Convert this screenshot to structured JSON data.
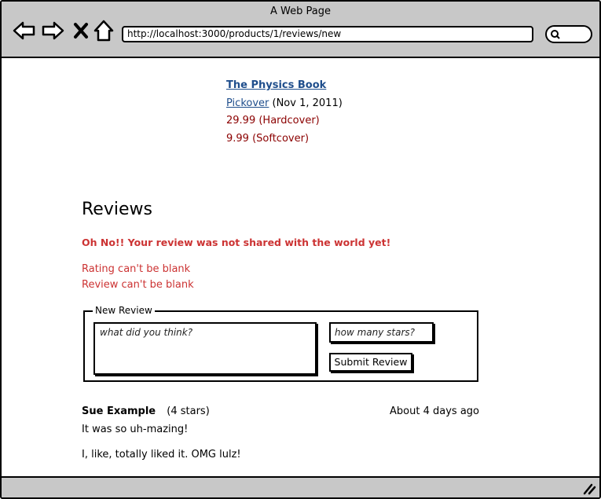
{
  "window": {
    "title": "A Web Page"
  },
  "toolbar": {
    "url": "http://localhost:3000/products/1/reviews/new",
    "icons": [
      "back-arrow-icon",
      "forward-arrow-icon",
      "close-x-icon",
      "home-icon",
      "search-icon"
    ]
  },
  "product": {
    "title": "The Physics Book",
    "author": "Pickover",
    "date": "(Nov 1, 2011)",
    "prices": [
      "29.99 (Hardcover)",
      "9.99 (Softcover)"
    ]
  },
  "reviews": {
    "heading": "Reviews",
    "flash": "Oh No!!  Your review was not shared with the world yet!",
    "errors": [
      "Rating can't be blank",
      "Review can't be blank"
    ],
    "form": {
      "legend": "New Review",
      "review_placeholder": "what did you think?",
      "stars_placeholder": "how many stars?",
      "submit_label": "Submit Review"
    },
    "items": [
      {
        "author": "Sue Example",
        "rating": "(4 stars)",
        "date": "About 4 days ago",
        "lines": [
          "It was so uh-mazing!",
          "I, like, totally liked it.  OMG lulz!"
        ]
      }
    ]
  },
  "colors": {
    "chrome": "#c8c8c8",
    "link": "#1f4e8c",
    "price": "#8b0000",
    "error": "#cc3333"
  }
}
